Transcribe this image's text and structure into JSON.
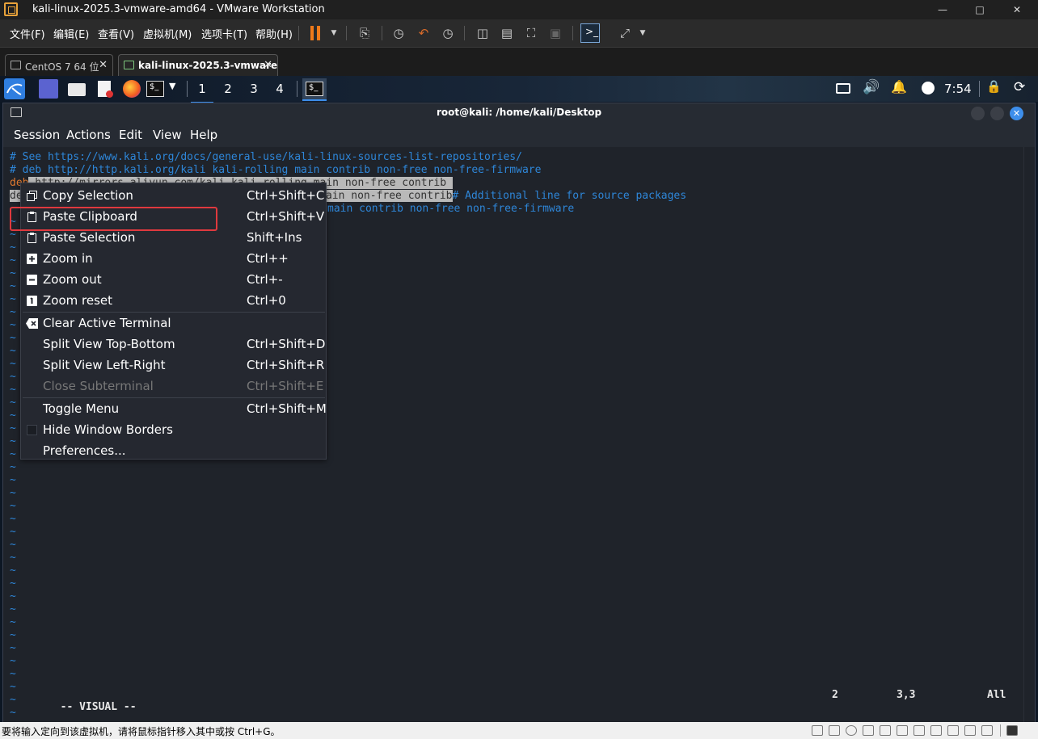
{
  "window": {
    "title": "kali-linux-2025.3-vmware-amd64 - VMware Workstation"
  },
  "vmware_menu": [
    "文件(F)",
    "编辑(E)",
    "查看(V)",
    "虚拟机(M)",
    "选项卡(T)",
    "帮助(H)"
  ],
  "vm_tabs": [
    {
      "label": "CentOS 7 64 位",
      "active": false
    },
    {
      "label": "kali-linux-2025.3-vmware...",
      "active": true
    }
  ],
  "panel": {
    "workspaces": [
      "1",
      "2",
      "3",
      "4"
    ],
    "current_workspace": "1",
    "clock": "7:54"
  },
  "terminal": {
    "title": "root@kali: /home/kali/Desktop",
    "menu": [
      "Session",
      "Actions",
      "Edit",
      "View",
      "Help"
    ],
    "lines": {
      "l1": "# See https://www.kali.org/docs/general-use/kali-linux-sources-list-repositories/",
      "l2": "# deb http://http.kali.org/kali kali-rolling main contrib non-free non-free-firmware",
      "l3a": "deb",
      "l3b": " http://mirrors.aliyun.com/kali kali-rolling main non-free contrib ",
      "l4a": "deb",
      "l4b": "g main non-free contrib",
      "l4c": "# Additional line for source packages",
      "l5": "main contrib non-free non-free-firmware"
    },
    "tilde": "~",
    "status": {
      "mode": "-- VISUAL --",
      "col1": "2",
      "col2": "3,3",
      "col3": "All"
    }
  },
  "context_menu": [
    {
      "label": "Copy Selection",
      "shortcut": "Ctrl+Shift+C",
      "icon": "copy-icon"
    },
    {
      "label": "Paste Clipboard",
      "shortcut": "Ctrl+Shift+V",
      "icon": "clipboard-icon"
    },
    {
      "label": "Paste Selection",
      "shortcut": "Shift+Ins",
      "icon": "clipboard-icon"
    },
    {
      "label": "Zoom in",
      "shortcut": "Ctrl++",
      "icon": "zoom-in-icon"
    },
    {
      "label": "Zoom out",
      "shortcut": "Ctrl+-",
      "icon": "zoom-out-icon"
    },
    {
      "label": "Zoom reset",
      "shortcut": "Ctrl+0",
      "icon": "zoom-reset-icon"
    },
    {
      "label": "Clear Active Terminal",
      "shortcut": "",
      "icon": "clear-icon"
    },
    {
      "label": "Split View Top-Bottom",
      "shortcut": "Ctrl+Shift+D"
    },
    {
      "label": "Split View Left-Right",
      "shortcut": "Ctrl+Shift+R"
    },
    {
      "label": "Close Subterminal",
      "shortcut": "Ctrl+Shift+E",
      "disabled": true
    },
    {
      "label": "Toggle Menu",
      "shortcut": "Ctrl+Shift+M"
    },
    {
      "label": "Hide Window Borders",
      "shortcut": "",
      "checkbox": true
    },
    {
      "label": "Preferences...",
      "shortcut": ""
    }
  ],
  "statusbar": {
    "message": "要将输入定向到该虚拟机，请将鼠标指针移入其中或按 Ctrl+G。"
  },
  "colors": {
    "accent": "#3d8eeb",
    "highlight_box": "#e0393e",
    "pause": "#f07a1a",
    "term_text": "#2e86d8"
  }
}
